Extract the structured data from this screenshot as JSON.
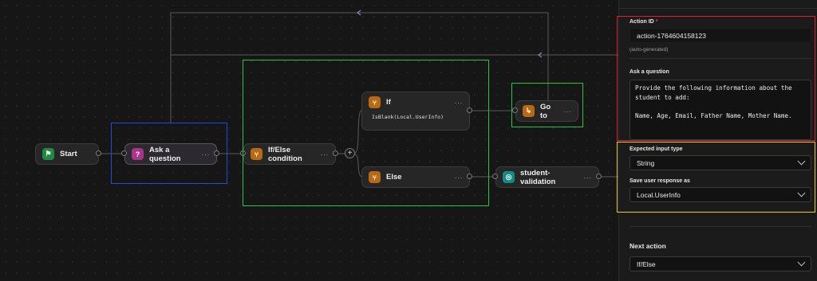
{
  "canvas": {
    "nodes": {
      "start": {
        "label": "Start",
        "icon": "flag-icon"
      },
      "ask": {
        "label": "Ask a question",
        "icon": "chat-question-icon",
        "menu": "···"
      },
      "ifelse": {
        "label": "If/Else condition",
        "icon": "branch-icon",
        "menu": "···"
      },
      "if_branch": {
        "label": "If",
        "menu": "···",
        "expression": "IsBlank(Local.UserInfo)"
      },
      "else_branch": {
        "label": "Else",
        "menu": "···"
      },
      "goto": {
        "label": "Go to",
        "icon": "redirect-icon",
        "menu": "···"
      },
      "validation": {
        "label": "student-validation",
        "icon": "validation-icon",
        "menu": "···"
      }
    },
    "plus_label": "+"
  },
  "panel": {
    "action_id": {
      "label": "Action ID",
      "required_mark": "*",
      "value": "action-1764604158123",
      "hint": "(auto-generated)"
    },
    "question": {
      "label": "Ask a question",
      "text": "Provide the following information about the\nstudent to add:\n\nName, Age, Email, Father Name, Mother Name."
    },
    "input_type": {
      "label": "Expected input type",
      "value": "String"
    },
    "save_as": {
      "label": "Save user response as",
      "value": "Local.UserInfo"
    },
    "next_action": {
      "label": "Next action",
      "value": "If/Else"
    }
  },
  "highlight_colors": {
    "panel_action": "#e0202a",
    "panel_input": "#f0cc1a",
    "ask_question_node": "#1f4fd8",
    "condition_group": "#28c53a",
    "goto_node": "#28c53a"
  }
}
